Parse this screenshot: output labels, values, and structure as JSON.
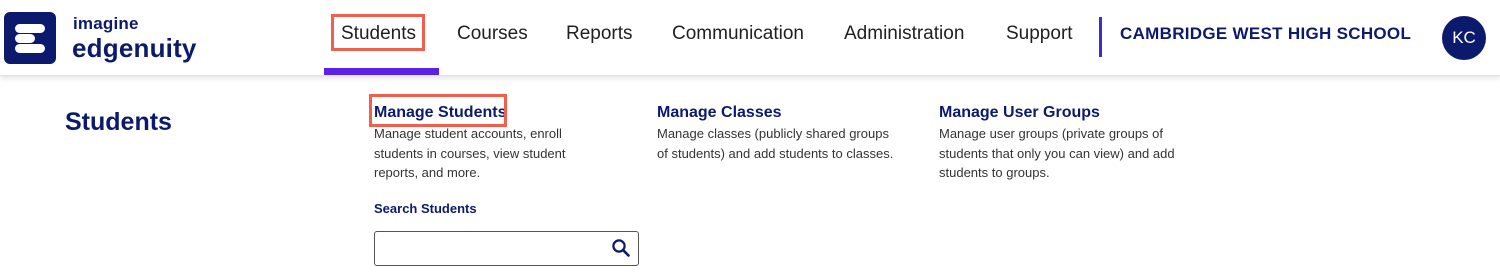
{
  "brand": {
    "line1": "imagine",
    "line2": "edgenuity",
    "color": "#0c1a6e"
  },
  "nav": {
    "items": [
      "Students",
      "Courses",
      "Reports",
      "Communication",
      "Administration",
      "Support"
    ],
    "active": "Students",
    "active_underline_color": "#5b21e6",
    "highlight_color": "#f0604f"
  },
  "school": {
    "name": "CAMBRIDGE WEST HIGH SCHOOL"
  },
  "user": {
    "initials": "KC"
  },
  "section": {
    "title": "Students"
  },
  "menu": [
    {
      "label": "Manage Students",
      "description_lines": [
        "Manage student accounts, enroll",
        "students in courses, view student",
        "reports, and more."
      ]
    },
    {
      "label": "Manage Classes",
      "description_lines": [
        "Manage classes (publicly shared groups",
        "of students) and add students to classes."
      ]
    },
    {
      "label": "Manage User Groups",
      "description_lines": [
        "Manage user groups (private groups of",
        "students that only you can view) and add",
        "students to groups."
      ]
    }
  ],
  "search": {
    "label": "Search Students",
    "value": "",
    "placeholder": "",
    "icon": "search-icon"
  }
}
